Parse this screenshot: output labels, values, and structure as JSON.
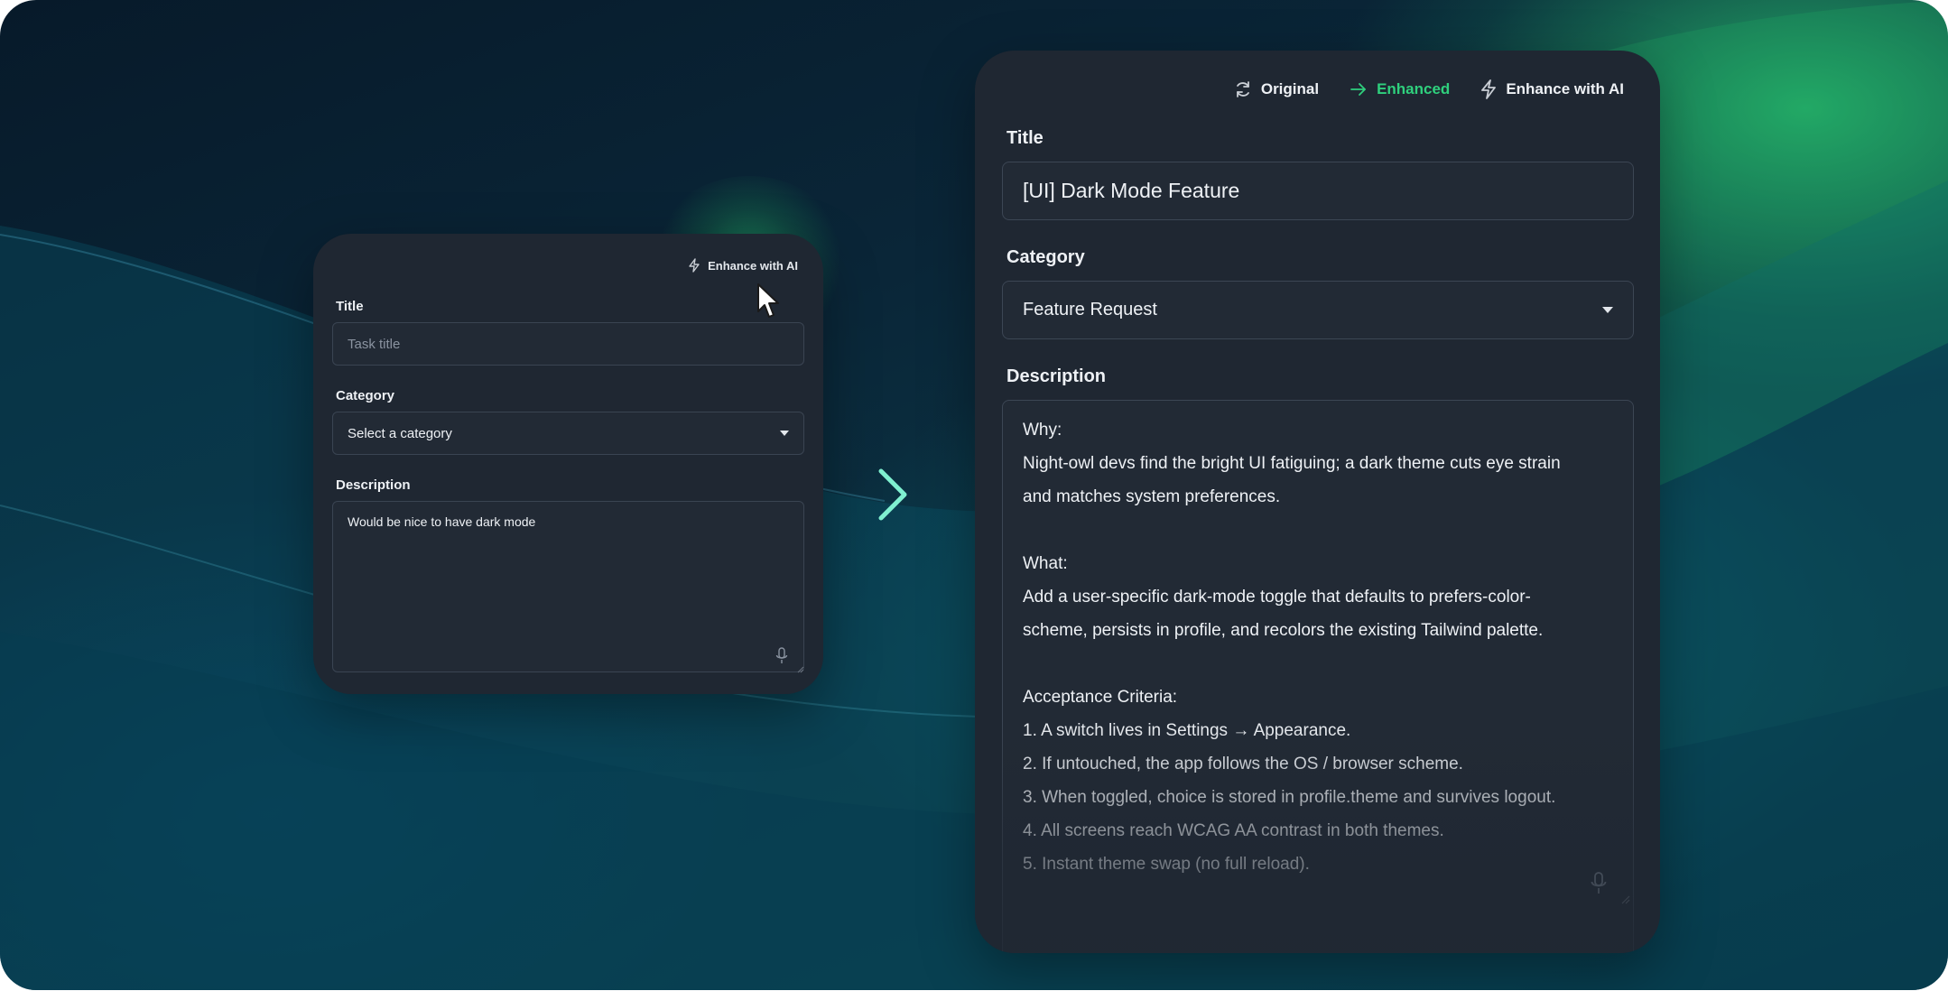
{
  "small_form": {
    "enhance_label": "Enhance with AI",
    "title_label": "Title",
    "title_placeholder": "Task title",
    "category_label": "Category",
    "category_value": "Select a category",
    "description_label": "Description",
    "description_value": "Would be nice to have dark mode",
    "icons": {
      "enhance": "lightning-icon",
      "caret": "caret-down-icon",
      "mic": "microphone-icon"
    }
  },
  "big_form": {
    "toolbar": {
      "original_label": "Original",
      "enhanced_label": "Enhanced",
      "enhance_label": "Enhance with AI",
      "active": "Enhanced",
      "active_color": "#2fd07d"
    },
    "title_label": "Title",
    "title_value": "[UI] Dark Mode Feature",
    "category_label": "Category",
    "category_value": "Feature Request",
    "description_label": "Description",
    "description_lines": [
      "Why:",
      "Night-owl devs find the bright UI fatiguing; a dark theme cuts eye strain",
      "and matches system preferences.",
      "",
      "What:",
      "Add a user-specific dark-mode toggle that defaults to prefers-color-",
      "scheme, persists in profile, and recolors the existing Tailwind palette.",
      "",
      "Acceptance Criteria:",
      "1. A switch lives in Settings → Appearance.",
      "2. If untouched, the app follows the OS / browser scheme.",
      "3. When toggled, choice is stored in profile.theme and survives logout.",
      "4. All screens reach WCAG AA contrast in both themes.",
      "5. Instant theme swap (no full reload)."
    ],
    "icons": {
      "original": "refresh-icon",
      "enhanced": "arrow-right-icon",
      "enhance": "lightning-icon",
      "caret": "caret-down-icon",
      "mic": "microphone-icon"
    }
  },
  "colors": {
    "card": "#1f2732",
    "accent": "#2fd07d",
    "text": "#eef1f5"
  }
}
